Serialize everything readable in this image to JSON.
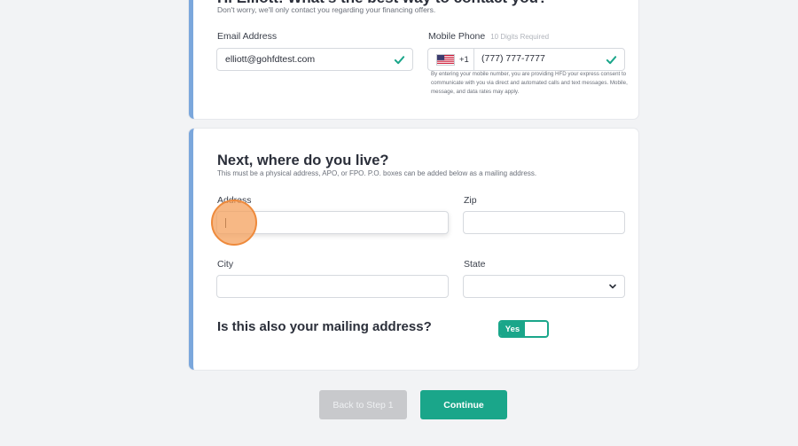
{
  "contact_card": {
    "heading": "Hi Elliott! What's the best way to contact you?",
    "subheading": "Don't worry, we'll only contact you regarding your financing offers.",
    "email_label": "Email Address",
    "email_value": "elliott@gohfdtest.com",
    "phone_label": "Mobile Phone",
    "phone_hint": "10 Digits Required",
    "phone_country_code": "+1",
    "phone_value": "(777) 777-7777",
    "consent_text": "By entering your mobile number, you are providing HFD your express consent to communicate with you via direct and automated calls and text messages. Mobile, message, and data rates may apply."
  },
  "address_card": {
    "heading": "Next, where do you live?",
    "subheading": "This must be a physical address, APO, or FPO. P.O. boxes can be added below as a mailing address.",
    "address_label": "Address",
    "address_value": "",
    "zip_label": "Zip",
    "zip_value": "",
    "city_label": "City",
    "city_value": "",
    "state_label": "State",
    "state_value": "",
    "mailing_question": "Is this also your mailing address?",
    "mailing_toggle_label": "Yes"
  },
  "buttons": {
    "back_label": "Back to Step 1",
    "continue_label": "Continue"
  },
  "colors": {
    "accent_green": "#1aa68a",
    "card_stripe_blue": "#7ba7dc",
    "touch_indicator_orange": "#f4a05c"
  },
  "icons": {
    "valid": "check-icon",
    "select": "chevron-down-icon",
    "country": "us-flag-icon"
  }
}
